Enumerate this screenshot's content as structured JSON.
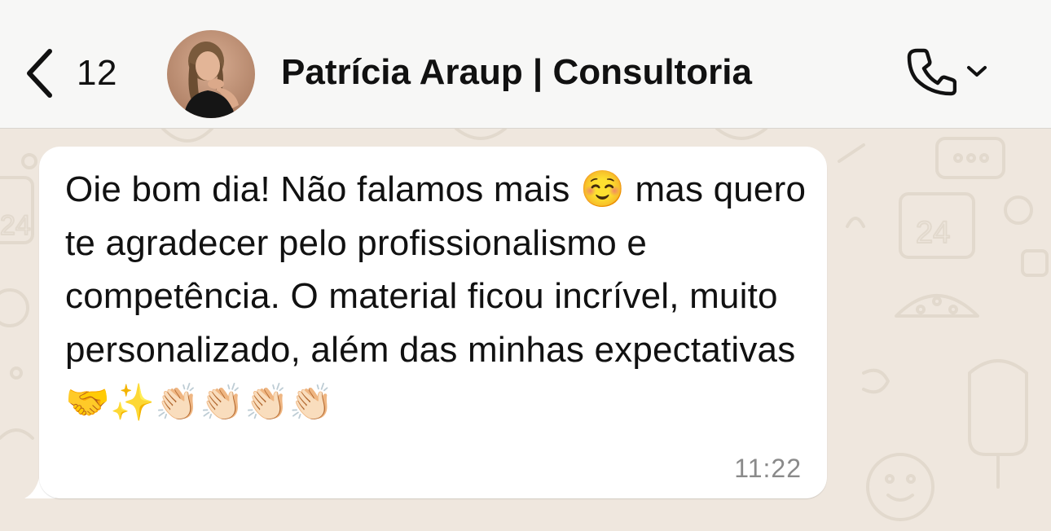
{
  "header": {
    "back_count": "12",
    "contact_name": "Patrícia Araup | Consultoria",
    "background": "#f7f7f6"
  },
  "icons": {
    "back": "chevron-left-icon",
    "call": "phone-icon",
    "call_menu": "chevron-down-icon"
  },
  "message": {
    "text": "Oie bom dia! Não falamos mais ☺️ mas quero te agradecer pelo profissionalismo e competência. O material ficou incrível, muito personalizado, além das minhas expectativas🤝✨👏🏻👏🏻👏🏻👏🏻",
    "time": "11:22",
    "bubble_color": "#ffffff"
  },
  "chat": {
    "wallpaper_color": "#efe7de"
  }
}
